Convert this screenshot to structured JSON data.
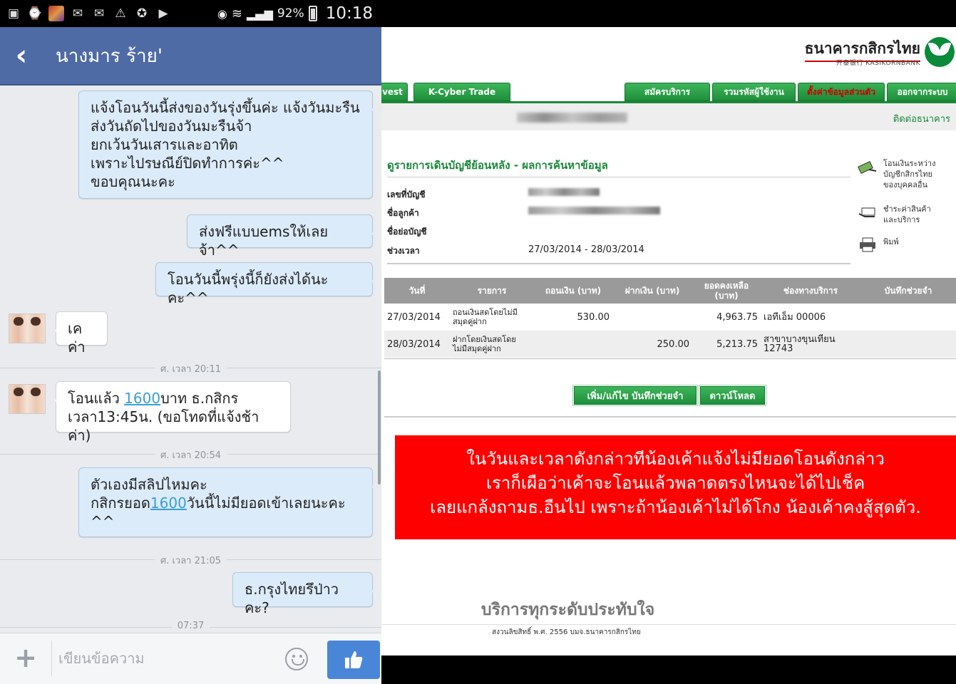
{
  "status_bar": {
    "battery": "92%",
    "time": "10:18"
  },
  "chat": {
    "title": "นางมาร ร้าย'",
    "messages": [
      {
        "text": "แจ้งโอนวันนี้ส่งของวันรุ่งขึ้นค่ะ แจ้งวันมะรืน\nส่งวันถัดไปของวันมะรืนจ้า\nยกเว้นวันเสารและอาทิต\nเพราะไปรษณีย์ปิดทำการค่ะ^^\nขอบคุณนะคะ"
      },
      {
        "text": "ส่งฟรีแบบemsให้เลยจ้า^^"
      },
      {
        "text": "โอนวันนี้พรุ่งนี้ก็ยังส่งได้นะคะ^^"
      },
      {
        "text": "เคค่า"
      },
      {
        "divider": "ศ. เวลา 20:11"
      },
      {
        "pre": "โอนแล้ว  ",
        "link": "1600",
        "post": "บาท ธ.กสิกร\nเวลา13:45น. (ขอโทดที่แจ้งช้าค่า)"
      },
      {
        "divider": "ศ. เวลา 20:54"
      },
      {
        "pre": "ตัวเองมีสลิปไหมคะ\nกสิกรยอด",
        "link": "1600",
        "post": "วันนี้ไม่มียอดเข้าเลยนะคะ\n^^"
      },
      {
        "divider": "ศ. เวลา 21:05"
      },
      {
        "text": "ธ.กรุงไทยรึป่าวคะ?"
      },
      {
        "divider": "07:37"
      }
    ],
    "composer_placeholder": "เขียนข้อความ"
  },
  "bank": {
    "logo_th": "ธนาคารกสิกรไทย",
    "logo_en": "开泰银行 KASIKORNBANK",
    "tabs": [
      "vest",
      "K-Cyber Trade",
      "สมัครบริการ",
      "รวมรหัสผู้ใช้งาน",
      "ตั้งค่าข้อมูลส่วนตัว",
      "ออกจากระบบ"
    ],
    "contact": "ติดต่อธนาคาร",
    "heading": "ดูรายการเดินบัญชีย้อนหลัง - ผลการค้นหาข้อมูล",
    "info_labels": [
      "เลขที่บัญชี",
      "ชื่อลูกค้า",
      "ชื่อย่อบัญชี",
      "ช่วงเวลา"
    ],
    "period": "27/03/2014 - 28/03/2014",
    "side_links": [
      "โอนเงินระหว่าง\nบัญชีกสิกรไทย\nของบุคคลอื่น",
      "ชำระค่าสินค้า\nและบริการ",
      "พิมพ์"
    ],
    "table": {
      "headers": [
        "วันที่",
        "รายการ",
        "ถอนเงิน (บาท)",
        "ฝากเงิน (บาท)",
        "ยอดคงเหลือ\n(บาท)",
        "ช่องทางบริการ",
        "บันทึกช่วยจำ"
      ],
      "rows": [
        [
          "27/03/2014",
          "ถอนเงินสดโดยไม่มี\nสมุดคู่ฝาก",
          "530.00",
          "",
          "4,963.75",
          "เอทีเอ็ม 00006",
          ""
        ],
        [
          "28/03/2014",
          "ฝากโดยเงินสดโดย\nไม่มีสมุดคู่ฝาก",
          "",
          "250.00",
          "5,213.75",
          "สาขาบางขุนเทียน\n12743",
          ""
        ]
      ]
    },
    "buttons": [
      "เพิ่ม/แก้ไข  บันทึกช่วยจำ",
      "ดาวน์โหลด"
    ],
    "notice": "ในวันและเวลาดังกล่าวทีน้องเค้าแจ้งไม่มียอดโอนดังกล่าว\nเราก็เผือว่าเค้าจะโอนแล้วพลาดตรงไหนจะได้ไปเช็ค\nเลยแกล้งถามธ.อืนไป เพราะถ้าน้องเค้าไม่ได้โกง น้องเค้าคงสู้สุดตัว.",
    "slogan": "บริการทุกระดับประทับใจ",
    "copyright": "สงวนลิขสิทธิ์ พ.ศ. 2556 บมจ.ธนาคารกสิกรไทย"
  }
}
